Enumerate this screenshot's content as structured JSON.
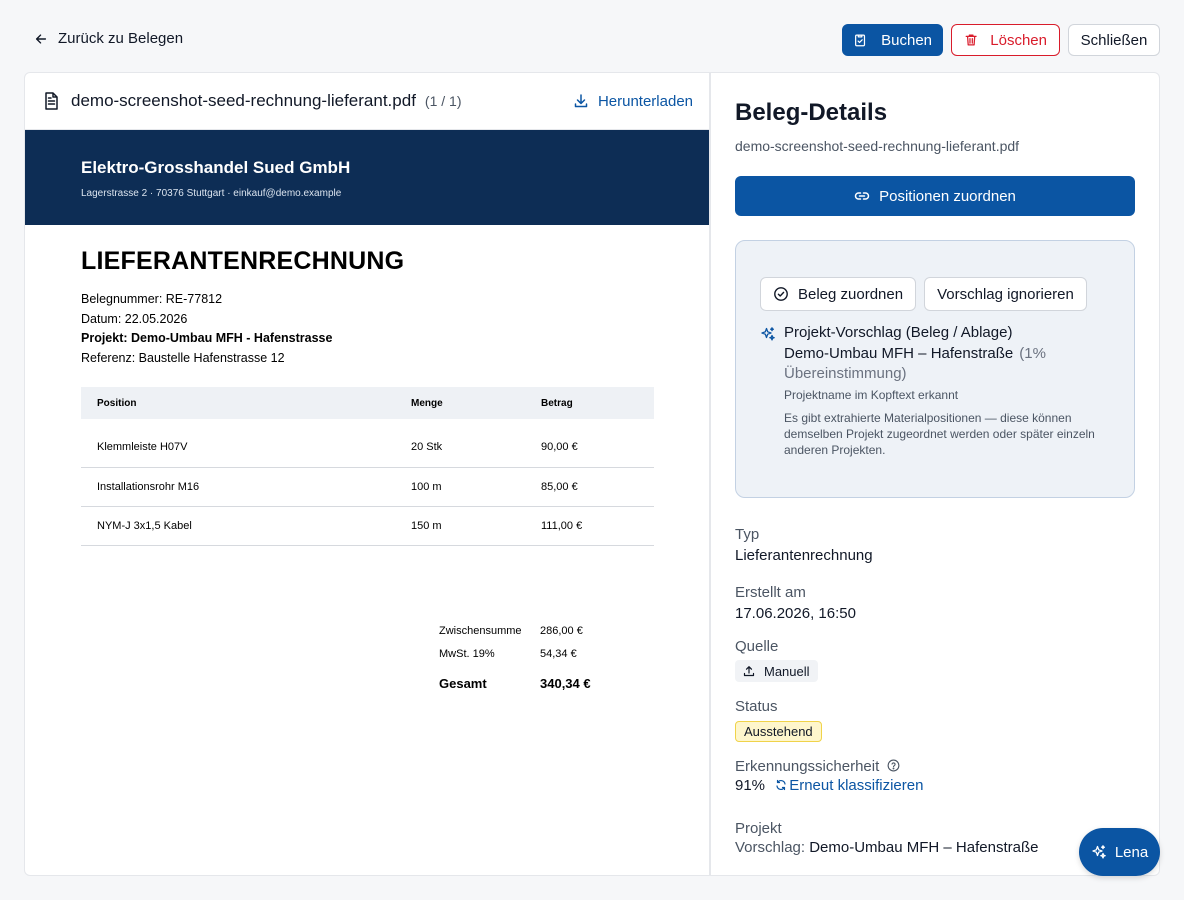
{
  "nav": {
    "back_label": "Zurück zu Belegen"
  },
  "toolbar": {
    "book_label": "Buchen",
    "delete_label": "Löschen",
    "close_label": "Schließen"
  },
  "viewer": {
    "filename": "demo-screenshot-seed-rechnung-lieferant.pdf",
    "pages": "(1 / 1)",
    "download_label": "Herunterladen"
  },
  "document": {
    "company": "Elektro-Grosshandel Sued GmbH",
    "address": "Lagerstrasse 2 · 70376 Stuttgart · einkauf@demo.example",
    "title": "LIEFERANTENRECHNUNG",
    "meta": [
      "Belegnummer: RE-77812",
      "Datum: 22.05.2026",
      "Projekt: Demo-Umbau MFH - Hafenstrasse",
      "Referenz: Baustelle Hafenstrasse 12"
    ],
    "table_headers": [
      "Position",
      "Menge",
      "Betrag"
    ],
    "rows": [
      [
        "Klemmleiste H07V",
        "20 Stk",
        "90,00 €"
      ],
      [
        "Installationsrohr M16",
        "100 m",
        "85,00 €"
      ],
      [
        "NYM-J 3x1,5 Kabel",
        "150 m",
        "111,00 €"
      ]
    ],
    "totals": {
      "subtotal_label": "Zwischensumme",
      "subtotal": "286,00 €",
      "tax_label": "MwSt. 19%",
      "tax": "54,34 €",
      "total_label": "Gesamt",
      "total": "340,34 €"
    }
  },
  "details": {
    "title": "Beleg-Details",
    "filename": "demo-screenshot-seed-rechnung-lieferant.pdf",
    "assign_label": "Positionen zuordnen",
    "suggestion": {
      "assign_doc_label": "Beleg zuordnen",
      "ignore_label": "Vorschlag ignorieren",
      "heading": "Projekt-Vorschlag (Beleg / Ablage)",
      "project": "Demo-Umbau MFH – Hafenstraße",
      "match": "(1% Übereinstimmung)",
      "reason": "Projektname im Kopftext erkannt",
      "note": "Es gibt extrahierte Materialpositionen — diese können demselben Projekt zugeordnet werden oder später einzeln anderen Projekten."
    },
    "type_label": "Typ",
    "type_value": "Lieferantenrechnung",
    "created_label": "Erstellt am",
    "created_value": "17.06.2026, 16:50",
    "source_label": "Quelle",
    "source_value": "Manuell",
    "status_label": "Status",
    "status_value": "Ausstehend",
    "confidence_label": "Erkennungssicherheit",
    "confidence_value": "91%",
    "reclassify_label": "Erneut klassifizieren",
    "project_label": "Projekt",
    "project_prefix": "Vorschlag:",
    "project_value": "Demo-Umbau MFH – Hafenstraße"
  },
  "assistant": {
    "label": "Lena"
  },
  "colors": {
    "primary": "#0b55a3",
    "danger": "#d91c2b",
    "doc_header": "#0d2d55",
    "status_pending": "#fef6cc"
  }
}
